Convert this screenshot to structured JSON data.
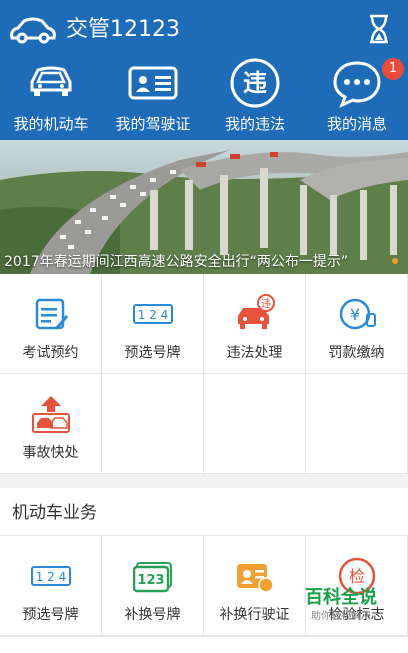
{
  "app": {
    "title": "交管12123"
  },
  "quick_nav": [
    {
      "label": "我的机动车",
      "icon": "car-icon"
    },
    {
      "label": "我的驾驶证",
      "icon": "license-icon"
    },
    {
      "label": "我的违法",
      "icon": "violation-icon",
      "icon_text": "违"
    },
    {
      "label": "我的消息",
      "icon": "message-icon",
      "badge": "1"
    }
  ],
  "banner": {
    "caption": "2017年春运期间江西高速公路安全出行“两公布一提示”"
  },
  "services": [
    {
      "label": "考试预约",
      "icon": "exam-booking-icon"
    },
    {
      "label": "预选号牌",
      "icon": "plate-select-icon",
      "icon_text": "1 2 4"
    },
    {
      "label": "违法处理",
      "icon": "violation-handling-icon",
      "icon_text": "违"
    },
    {
      "label": "罚款缴纳",
      "icon": "fine-payment-icon",
      "icon_text": "¥"
    },
    {
      "label": "事故快处",
      "icon": "accident-icon"
    }
  ],
  "vehicle_section": {
    "title": "机动车业务",
    "items": [
      {
        "label": "预选号牌",
        "icon": "plate-select-icon",
        "icon_text": "1 2 4"
      },
      {
        "label": "补换号牌",
        "icon": "plate-replace-icon",
        "icon_text": "123"
      },
      {
        "label": "补换行驶证",
        "icon": "driving-permit-icon"
      },
      {
        "label": "检验标志",
        "icon": "inspection-icon",
        "icon_text": "检"
      }
    ]
  },
  "watermark": {
    "main": "百科全说",
    "sub": "助你轻松解决"
  },
  "colors": {
    "header": "#1e6bb8",
    "accent_blue": "#2b8ad6",
    "accent_red": "#e5533c",
    "accent_green": "#28a05a",
    "accent_orange": "#f0a030"
  }
}
